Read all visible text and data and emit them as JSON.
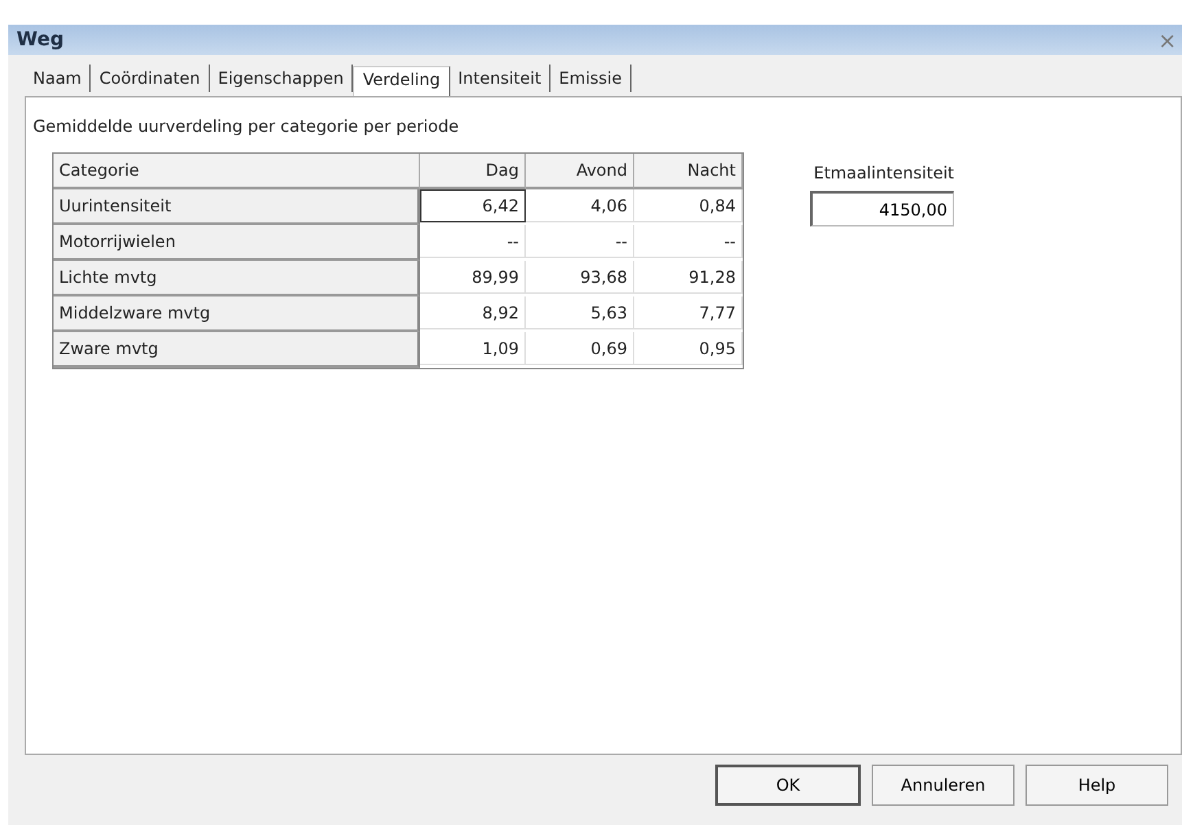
{
  "window": {
    "title": "Weg",
    "close": "×"
  },
  "tabs": [
    {
      "label": "Naam",
      "selected": false
    },
    {
      "label": "Coördinaten",
      "selected": false
    },
    {
      "label": "Eigenschappen",
      "selected": false
    },
    {
      "label": "Verdeling",
      "selected": true
    },
    {
      "label": "Intensiteit",
      "selected": false
    },
    {
      "label": "Emissie",
      "selected": false
    }
  ],
  "heading": "Gemiddelde uurverdeling per categorie per periode",
  "table": {
    "columns": [
      "Categorie",
      "Dag",
      "Avond",
      "Nacht"
    ],
    "rows": [
      [
        {
          "text": "Uurintensiteit",
          "selected": false
        },
        {
          "text": "6,42",
          "selected": true
        },
        {
          "text": "4,06",
          "selected": false
        },
        {
          "text": "0,84",
          "selected": false
        }
      ],
      [
        {
          "text": "Motorrijwielen",
          "selected": false
        },
        {
          "text": "--",
          "selected": false
        },
        {
          "text": "--",
          "selected": false
        },
        {
          "text": "--",
          "selected": false
        }
      ],
      [
        {
          "text": "Lichte mvtg",
          "selected": false
        },
        {
          "text": "89,99",
          "selected": false
        },
        {
          "text": "93,68",
          "selected": false
        },
        {
          "text": "91,28",
          "selected": false
        }
      ],
      [
        {
          "text": "Middelzware mvtg",
          "selected": false
        },
        {
          "text": "8,92",
          "selected": false
        },
        {
          "text": "5,63",
          "selected": false
        },
        {
          "text": "7,77",
          "selected": false
        }
      ],
      [
        {
          "text": "Zware mvtg",
          "selected": false
        },
        {
          "text": "1,09",
          "selected": false
        },
        {
          "text": "0,69",
          "selected": false
        },
        {
          "text": "0,95",
          "selected": false
        }
      ]
    ]
  },
  "etmaal": {
    "label": "Etmaalintensiteit",
    "value": "4150,00"
  },
  "buttons": [
    {
      "label": "OK",
      "default": true
    },
    {
      "label": "Annuleren",
      "default": false
    },
    {
      "label": "Help",
      "default": false
    }
  ]
}
